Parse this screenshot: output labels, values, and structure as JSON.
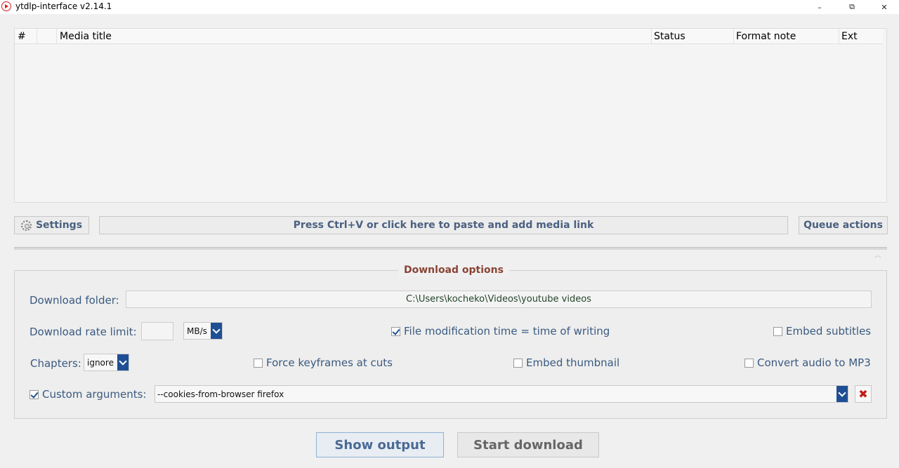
{
  "window": {
    "title": "ytdlp-interface v2.14.1",
    "minimize": "–",
    "maximize": "⧉",
    "close": "✕"
  },
  "media_list": {
    "columns": [
      "#",
      "Media title",
      "Status",
      "Format note",
      "Ext"
    ],
    "rows": []
  },
  "toolbar": {
    "settings_label": "Settings",
    "paste_label": "Press Ctrl+V or click here to paste and add media link",
    "queue_actions_label": "Queue actions"
  },
  "download_options": {
    "title": "Download options",
    "folder_label": "Download folder:",
    "folder_value": "C:\\Users\\kocheko\\Videos\\youtube videos",
    "rate_limit_label": "Download rate limit:",
    "rate_limit_value": "",
    "rate_unit": "MB/s",
    "chapters_label": "Chapters:",
    "chapters_value": "ignore",
    "file_mod_time": {
      "label": "File modification time = time of writing",
      "checked": true
    },
    "embed_subtitles": {
      "label": "Embed subtitles",
      "checked": false
    },
    "force_keyframes": {
      "label": "Force keyframes at cuts",
      "checked": false
    },
    "embed_thumbnail": {
      "label": "Embed thumbnail",
      "checked": false
    },
    "convert_mp3": {
      "label": "Convert audio to MP3",
      "checked": false
    },
    "custom_args": {
      "label": "Custom arguments:",
      "checked": true,
      "value": "--cookies-from-browser firefox"
    },
    "clear_icon": "✖"
  },
  "actions": {
    "show_output_label": "Show output",
    "start_download_label": "Start download"
  },
  "icons": {
    "collapse": "︿"
  },
  "colors": {
    "label_blue": "#3a5a80",
    "group_title": "#8a4434",
    "accent_dropdown": "#1e4f94",
    "clear_red": "#c41a1a"
  }
}
